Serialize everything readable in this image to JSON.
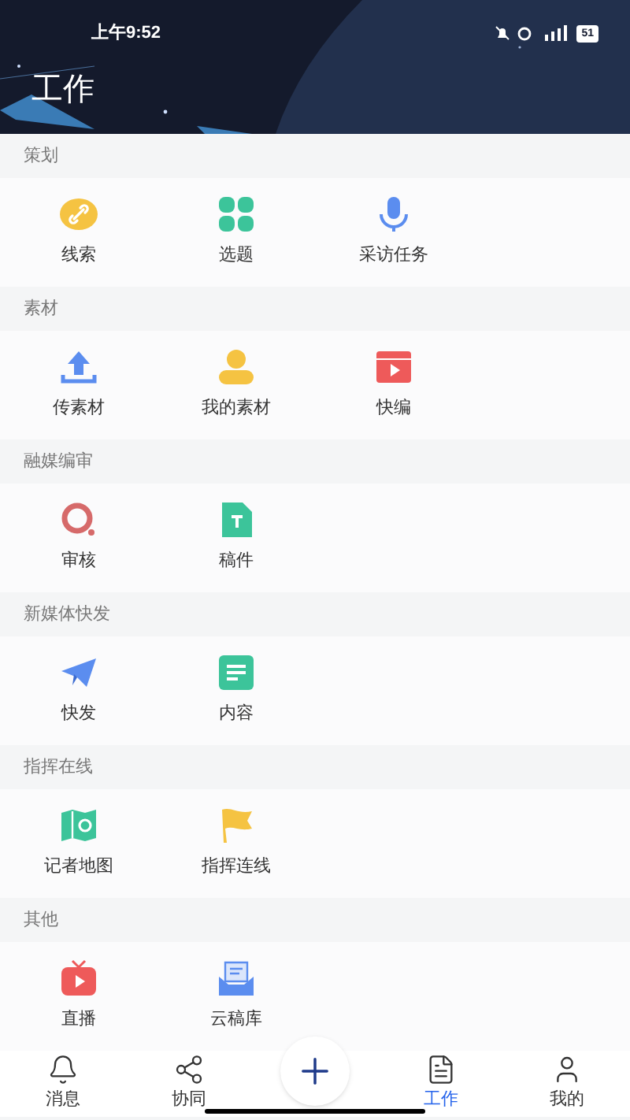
{
  "status_bar": {
    "time": "上午9:52",
    "battery": "51"
  },
  "header": {
    "title": "工作"
  },
  "sections": [
    {
      "title": "策划",
      "items": [
        {
          "label": "线索"
        },
        {
          "label": "选题"
        },
        {
          "label": "采访任务"
        }
      ]
    },
    {
      "title": "素材",
      "items": [
        {
          "label": "传素材"
        },
        {
          "label": "我的素材"
        },
        {
          "label": "快编"
        }
      ]
    },
    {
      "title": "融媒编审",
      "items": [
        {
          "label": "审核"
        },
        {
          "label": "稿件"
        }
      ]
    },
    {
      "title": "新媒体快发",
      "items": [
        {
          "label": "快发"
        },
        {
          "label": "内容"
        }
      ]
    },
    {
      "title": "指挥在线",
      "items": [
        {
          "label": "记者地图"
        },
        {
          "label": "指挥连线"
        }
      ]
    },
    {
      "title": "其他",
      "items": [
        {
          "label": "直播"
        },
        {
          "label": "云稿库"
        }
      ]
    }
  ],
  "bottom_nav": [
    {
      "kind": "tab",
      "label": "消息",
      "selected": false
    },
    {
      "kind": "tab",
      "label": "协同",
      "selected": false
    },
    {
      "kind": "add"
    },
    {
      "kind": "tab",
      "label": "工作",
      "selected": true
    },
    {
      "kind": "tab",
      "label": "我的",
      "selected": false
    }
  ]
}
